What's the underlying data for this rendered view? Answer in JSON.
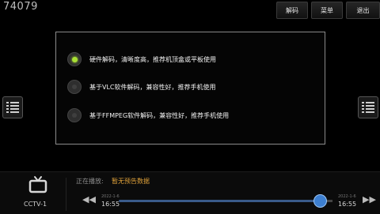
{
  "channel_number": "74079",
  "top_buttons": [
    {
      "label": "解码"
    },
    {
      "label": "菜单"
    },
    {
      "label": "退出"
    }
  ],
  "decode_dialog": {
    "options": [
      {
        "label": "硬件解码，清晰度高，推荐机顶盒或平板使用",
        "selected": true
      },
      {
        "label": "基于VLC软件解码，兼容性好，推荐手机使用",
        "selected": false
      },
      {
        "label": "基于FFMPEG软件解码，兼容性好，推荐手机使用",
        "selected": false
      }
    ]
  },
  "player_bar": {
    "channel_name": "CCTV-1",
    "now_playing_label": "正在播放:",
    "now_playing_value": "暂无预告数据",
    "start_date": "2022-1-6",
    "start_time": "16:55",
    "end_date": "2022-1-6",
    "end_time": "16:55",
    "progress": 0.94
  },
  "icons": {
    "left_list": "list-icon",
    "right_list": "list-icon",
    "tv": "tv-icon",
    "rewind": "rewind-icon",
    "fast_forward": "fast-forward-icon"
  }
}
